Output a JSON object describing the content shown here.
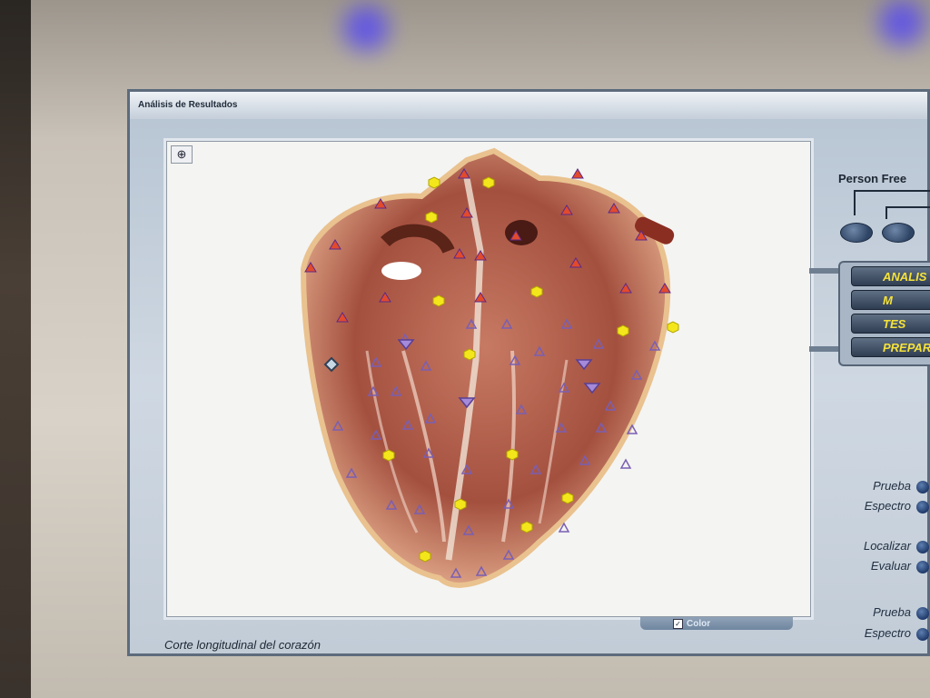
{
  "window": {
    "title": "Análisis de Resultados"
  },
  "viewer": {
    "caption": "Corte longitudinal del corazón",
    "color_toggle": {
      "label": "Color",
      "checked": true
    },
    "zoom_icon": "zoom-in-icon"
  },
  "panel": {
    "title": "Person Free",
    "menu": [
      "ANALIS",
      "M",
      "TES",
      "PREPARA"
    ],
    "side_items": [
      {
        "label": "Prueba"
      },
      {
        "label": "Espectro"
      },
      {
        "label": "Localizar"
      },
      {
        "label": "Evaluar"
      },
      {
        "label": "Prueba"
      },
      {
        "label": "Espectro"
      }
    ]
  },
  "colors": {
    "marker_red": "#e24a2c",
    "marker_yellow": "#f3e61b",
    "marker_purple": "#7a5fb3",
    "menu_text": "#f5e23a"
  }
}
